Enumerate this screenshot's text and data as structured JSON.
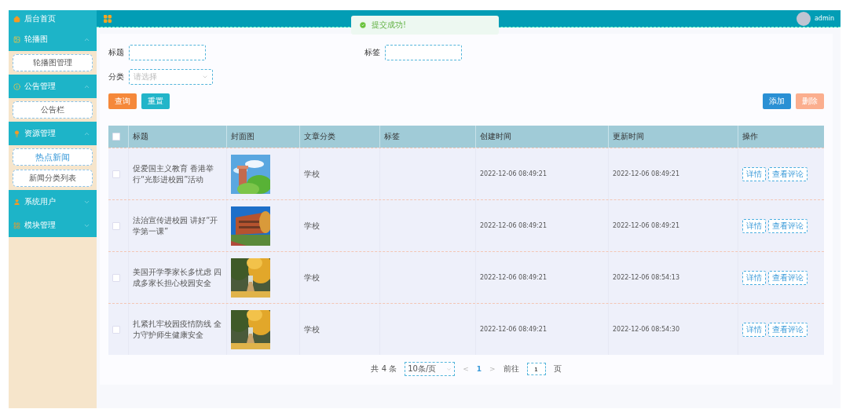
{
  "sidebar": {
    "items": [
      {
        "kind": "link",
        "label": "后台首页"
      },
      {
        "kind": "group",
        "label": "轮播图",
        "expanded": true,
        "children": [
          {
            "label": "轮播图管理",
            "selected": false
          }
        ]
      },
      {
        "kind": "group",
        "label": "公告管理",
        "expanded": true,
        "children": [
          {
            "label": "公告栏",
            "selected": false
          }
        ]
      },
      {
        "kind": "group",
        "label": "资源管理",
        "expanded": true,
        "children": [
          {
            "label": "热点新闻",
            "selected": true
          },
          {
            "label": "新闻分类列表",
            "selected": false
          }
        ]
      },
      {
        "kind": "group",
        "label": "系统用户",
        "expanded": false
      },
      {
        "kind": "group",
        "label": "模块管理",
        "expanded": false
      }
    ]
  },
  "header": {
    "user": "admin"
  },
  "toast": {
    "message": "提交成功!"
  },
  "filters": {
    "title_label": "标题",
    "tag_label": "标签",
    "category_label": "分类",
    "category_placeholder": "请选择"
  },
  "buttons": {
    "search": "查询",
    "reset": "重置",
    "add": "添加",
    "delete": "删除",
    "delete_disabled": true
  },
  "table": {
    "columns": [
      {
        "kind": "check",
        "checked": false
      },
      {
        "kind": "text",
        "label": "标题"
      },
      {
        "kind": "text",
        "label": "封面图"
      },
      {
        "kind": "text",
        "label": "文章分类"
      },
      {
        "kind": "text",
        "label": "标签"
      },
      {
        "kind": "text",
        "label": "创建时间"
      },
      {
        "kind": "text",
        "label": "更新时间"
      },
      {
        "kind": "text",
        "label": "操作"
      }
    ],
    "rows": [
      {
        "checked": false,
        "title": "促爱国主义教育 香港举行“光影进校园”活动",
        "category": "学校",
        "created": "2022-12-06 08:49:21",
        "updated": "2022-12-06 08:49:21",
        "actions": [
          "详情",
          "查看评论"
        ]
      },
      {
        "checked": false,
        "title": "法治宣传进校园 讲好“开学第一课”",
        "category": "学校",
        "created": "2022-12-06 08:49:21",
        "updated": "2022-12-06 08:49:21",
        "actions": [
          "详情",
          "查看评论"
        ]
      },
      {
        "checked": false,
        "title": "美国开学季家长多忧虑 四成多家长担心校园安全",
        "category": "学校",
        "created": "2022-12-06 08:49:21",
        "updated": "2022-12-06 08:54:13",
        "actions": [
          "详情",
          "查看评论"
        ]
      },
      {
        "checked": false,
        "title": "扎紧扎牢校园疫情防线 全力守护师生健康安全",
        "category": "学校",
        "created": "2022-12-06 08:49:21",
        "updated": "2022-12-06 08:54:30",
        "actions": [
          "详情",
          "查看评论"
        ]
      }
    ]
  },
  "pagination": {
    "total": "共 4 条",
    "page_size": "10条/页",
    "prev": "<",
    "pages": [
      {
        "label": "1",
        "selected": true
      }
    ],
    "next": ">",
    "goto_label": "前往",
    "goto_value": "1",
    "goto_suffix": "页"
  }
}
